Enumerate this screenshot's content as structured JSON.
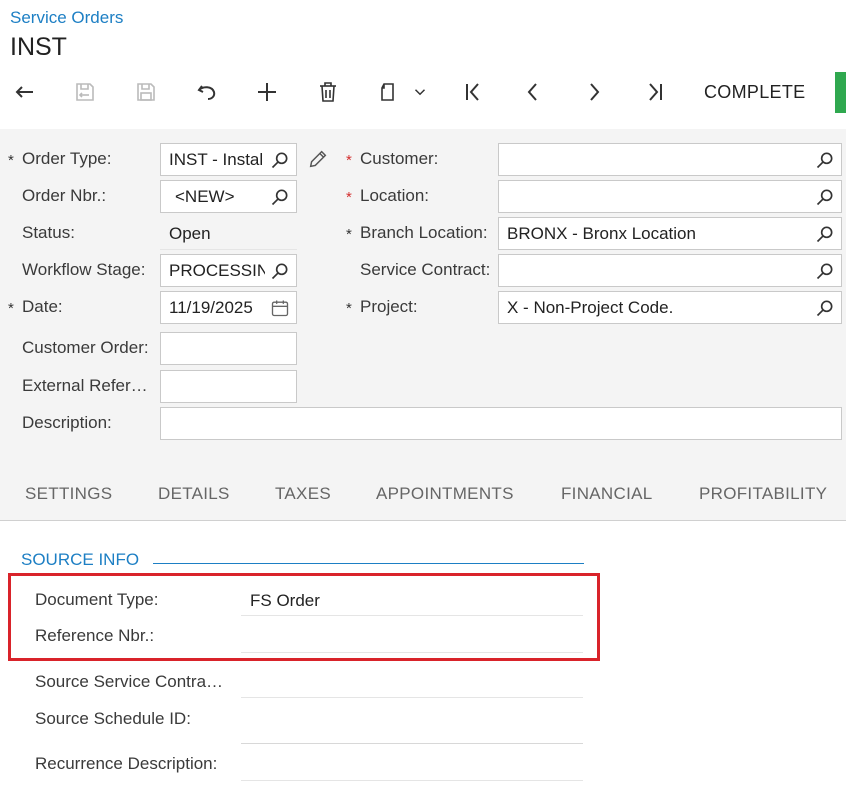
{
  "breadcrumb": "Service Orders",
  "title": "INST",
  "toolbar": {
    "complete_label": "COMPLETE"
  },
  "form": {
    "order_type": {
      "label": "Order Type:",
      "value": "INST - Instal"
    },
    "order_nbr": {
      "label": "Order Nbr.:",
      "value": "<NEW>"
    },
    "status": {
      "label": "Status:",
      "value": "Open"
    },
    "workflow_stage": {
      "label": "Workflow Stage:",
      "value": "PROCESSIN"
    },
    "date": {
      "label": "Date:",
      "value": "11/19/2025"
    },
    "customer_order": {
      "label": "Customer Order:",
      "value": ""
    },
    "external_ref": {
      "label": "External Refer…",
      "value": ""
    },
    "description": {
      "label": "Description:",
      "value": ""
    },
    "customer": {
      "label": "Customer:",
      "value": ""
    },
    "location": {
      "label": "Location:",
      "value": ""
    },
    "branch_location": {
      "label": "Branch Location:",
      "value": "BRONX - Bronx Location"
    },
    "service_contract": {
      "label": "Service Contract:",
      "value": ""
    },
    "project": {
      "label": "Project:",
      "value": "X - Non-Project Code."
    }
  },
  "tabs": [
    "SETTINGS",
    "DETAILS",
    "TAXES",
    "APPOINTMENTS",
    "FINANCIAL",
    "PROFITABILITY"
  ],
  "source_info": {
    "title": "SOURCE INFO",
    "document_type": {
      "label": "Document Type:",
      "value": "FS Order"
    },
    "reference_nbr": {
      "label": "Reference Nbr.:",
      "value": ""
    },
    "source_service_contract": {
      "label": "Source Service Contra…",
      "value": ""
    },
    "source_schedule_id": {
      "label": "Source Schedule ID:",
      "value": ""
    },
    "recurrence_description": {
      "label": "Recurrence Description:",
      "value": ""
    }
  },
  "colors": {
    "accent": "#1d7fc4",
    "required": "#d32f2f",
    "highlight": "#d9232a",
    "complete": "#2fa84f"
  }
}
